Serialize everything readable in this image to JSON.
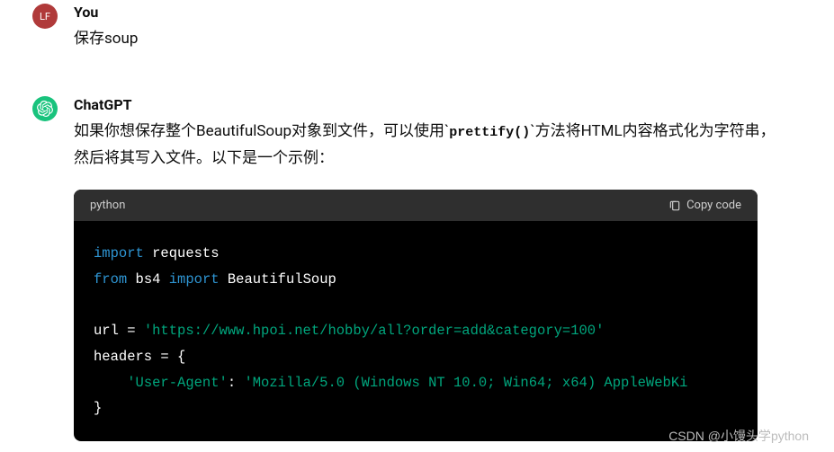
{
  "user": {
    "avatar_text": "LF",
    "name": "You",
    "message": "保存soup"
  },
  "assistant": {
    "name": "ChatGPT",
    "text_before_code": "如果你想保存整个BeautifulSoup对象到文件，可以使用`",
    "inline_code": "prettify()",
    "text_after_code": "`方法将HTML内容格式化为字符串，然后将其写入文件。以下是一个示例：",
    "code": {
      "language": "python",
      "copy_label": "Copy code",
      "tokens": [
        {
          "t": "import",
          "c": "kw"
        },
        {
          "t": " ",
          "c": ""
        },
        {
          "t": "requests",
          "c": "mod"
        },
        {
          "t": "\n",
          "c": ""
        },
        {
          "t": "from",
          "c": "kw"
        },
        {
          "t": " ",
          "c": ""
        },
        {
          "t": "bs4",
          "c": "mod"
        },
        {
          "t": " ",
          "c": ""
        },
        {
          "t": "import",
          "c": "kw"
        },
        {
          "t": " ",
          "c": ""
        },
        {
          "t": "BeautifulSoup",
          "c": "mod"
        },
        {
          "t": "\n\n",
          "c": ""
        },
        {
          "t": "url = ",
          "c": "var"
        },
        {
          "t": "'https://www.hpoi.net/hobby/all?order=add&category=100'",
          "c": "str"
        },
        {
          "t": "\n",
          "c": ""
        },
        {
          "t": "headers = {",
          "c": "var"
        },
        {
          "t": "\n    ",
          "c": ""
        },
        {
          "t": "'User-Agent'",
          "c": "str"
        },
        {
          "t": ": ",
          "c": "var"
        },
        {
          "t": "'Mozilla/5.0 (Windows NT 10.0; Win64; x64) AppleWebKi",
          "c": "str"
        },
        {
          "t": "\n",
          "c": ""
        },
        {
          "t": "}",
          "c": "var"
        }
      ]
    }
  },
  "watermark": "CSDN @小馒头学python"
}
